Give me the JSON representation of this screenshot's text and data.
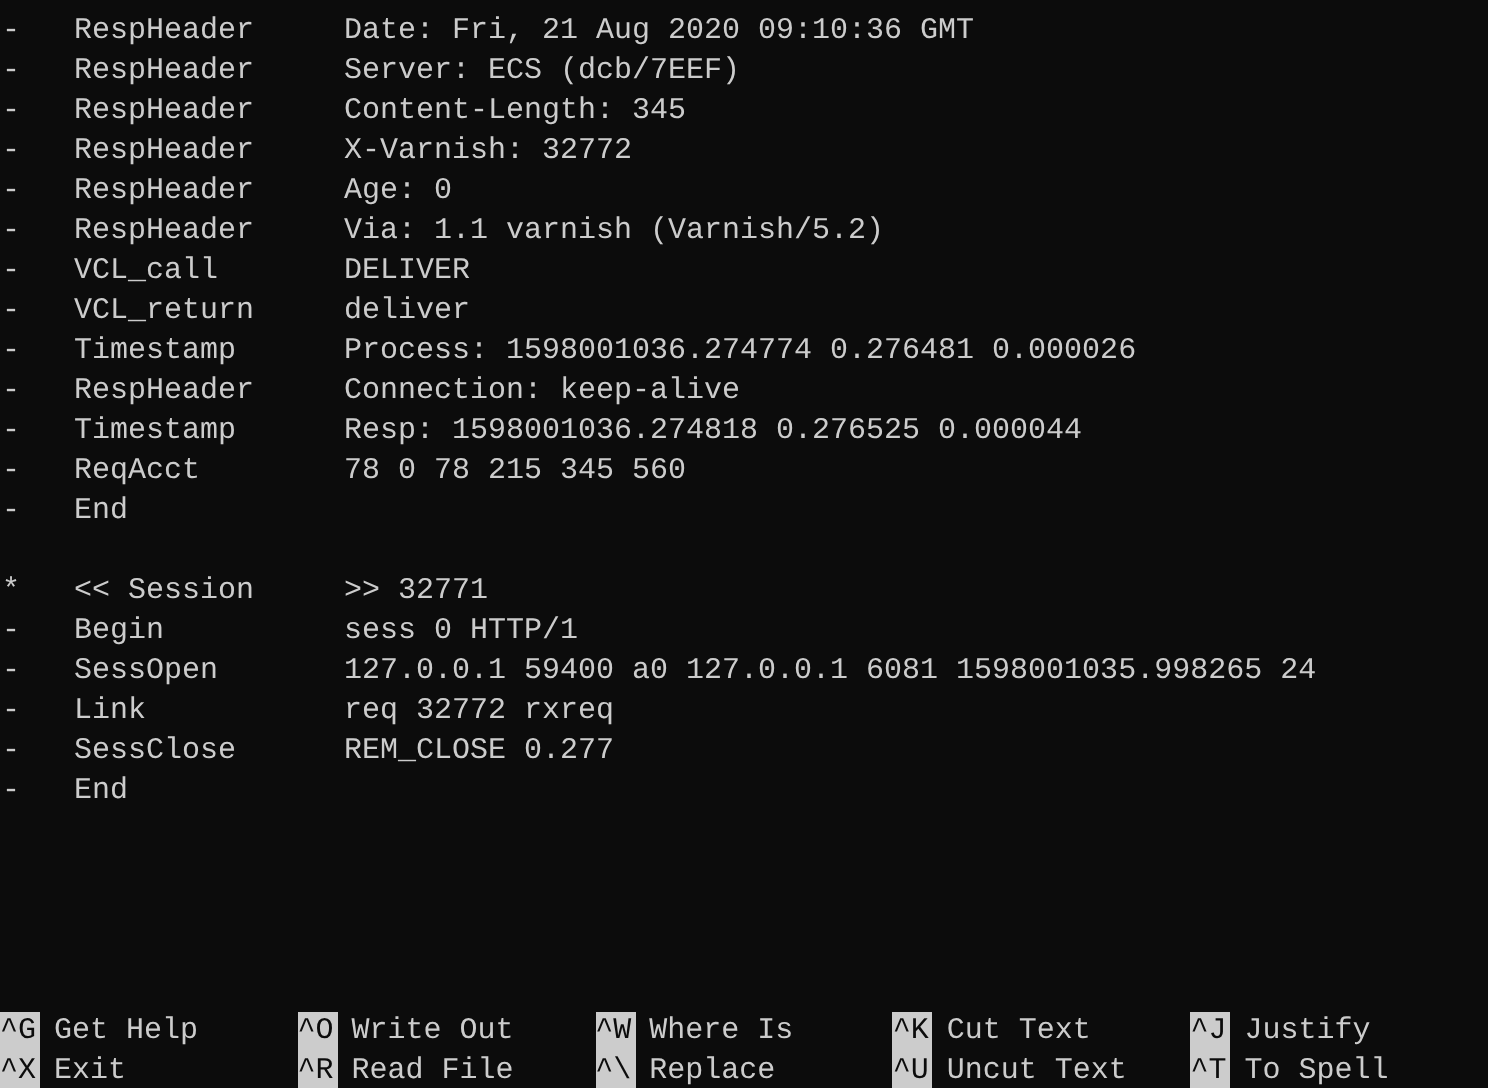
{
  "log": {
    "records": [
      {
        "lines": [
          {
            "marker": "-",
            "tag": "RespHeader",
            "value": "Date: Fri, 21 Aug 2020 09:10:36 GMT"
          },
          {
            "marker": "-",
            "tag": "RespHeader",
            "value": "Server: ECS (dcb/7EEF)"
          },
          {
            "marker": "-",
            "tag": "RespHeader",
            "value": "Content-Length: 345"
          },
          {
            "marker": "-",
            "tag": "RespHeader",
            "value": "X-Varnish: 32772"
          },
          {
            "marker": "-",
            "tag": "RespHeader",
            "value": "Age: 0"
          },
          {
            "marker": "-",
            "tag": "RespHeader",
            "value": "Via: 1.1 varnish (Varnish/5.2)"
          },
          {
            "marker": "-",
            "tag": "VCL_call",
            "value": "DELIVER"
          },
          {
            "marker": "-",
            "tag": "VCL_return",
            "value": "deliver"
          },
          {
            "marker": "-",
            "tag": "Timestamp",
            "value": "Process: 1598001036.274774 0.276481 0.000026"
          },
          {
            "marker": "-",
            "tag": "RespHeader",
            "value": "Connection: keep-alive"
          },
          {
            "marker": "-",
            "tag": "Timestamp",
            "value": "Resp: 1598001036.274818 0.276525 0.000044"
          },
          {
            "marker": "-",
            "tag": "ReqAcct",
            "value": "78 0 78 215 345 560"
          },
          {
            "marker": "-",
            "tag": "End"
          }
        ]
      },
      {
        "lines": [
          {
            "marker": "*",
            "tag": "<< Session",
            "value": ">> 32771"
          },
          {
            "marker": "-",
            "tag": "Begin",
            "value": "sess 0 HTTP/1"
          },
          {
            "marker": "-",
            "tag": "SessOpen",
            "value": "127.0.0.1 59400 a0 127.0.0.1 6081 1598001035.998265 24"
          },
          {
            "marker": "-",
            "tag": "Link",
            "value": "req 32772 rxreq"
          },
          {
            "marker": "-",
            "tag": "SessClose",
            "value": "REM_CLOSE 0.277"
          },
          {
            "marker": "-",
            "tag": "End"
          }
        ]
      }
    ]
  },
  "shortcuts": [
    [
      {
        "key": "^G",
        "label": "Get Help"
      },
      {
        "key": "^O",
        "label": "Write Out"
      },
      {
        "key": "^W",
        "label": "Where Is"
      },
      {
        "key": "^K",
        "label": "Cut Text"
      },
      {
        "key": "^J",
        "label": "Justify"
      }
    ],
    [
      {
        "key": "^X",
        "label": "Exit"
      },
      {
        "key": "^R",
        "label": "Read File"
      },
      {
        "key": "^\\",
        "label": "Replace"
      },
      {
        "key": "^U",
        "label": "Uncut Text"
      },
      {
        "key": "^T",
        "label": "To Spell"
      }
    ]
  ]
}
